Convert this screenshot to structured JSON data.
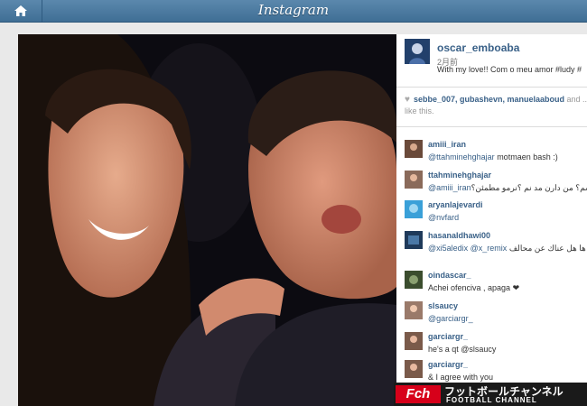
{
  "app": {
    "title": "Instagram",
    "home_icon": "house-icon"
  },
  "post": {
    "owner": {
      "username": "oscar_emboaba",
      "time": "2月前",
      "caption": "With my love!! Com o meu amor #ludy #"
    },
    "likes": {
      "icon": "heart-icon",
      "users": "sebbe_007, gubashevn, manuelaaboud",
      "suffix": "and ... like this."
    }
  },
  "comments": [
    {
      "user": "amiii_iran",
      "mention": "@ttahminehghajar",
      "text": " motmaen bash :)"
    },
    {
      "user": "ttahminehghajar",
      "mention": "@amiii_iran",
      "text": "؟ حالا مطمئنی باشم؟ من دارن مد نم ؟نرمو مطمئن؟"
    },
    {
      "user": "aryanlajevardi",
      "mention": "@nvfard",
      "text": ""
    },
    {
      "user": "hasanaldhawi00",
      "mention": "@xi5aledix @x_remix",
      "text": " اللاعبين اسكو الحسن مع ها هل عناك عن محالف"
    },
    {
      "user": "oindascar_",
      "mention": "",
      "text": "Achei ofenciva , apaga ❤"
    },
    {
      "user": "slsaucy",
      "mention": "@garciargr_",
      "text": ""
    },
    {
      "user": "garciargr_",
      "mention": "",
      "text": "he's a qt @slsaucy"
    },
    {
      "user": "garciargr_",
      "mention": "",
      "text": "& I agree with you"
    }
  ],
  "watermark": {
    "mark": "Fch",
    "jp": "フットボールチャンネル",
    "en": "FOOTBALL CHANNEL",
    "accent": "#d7001a"
  }
}
